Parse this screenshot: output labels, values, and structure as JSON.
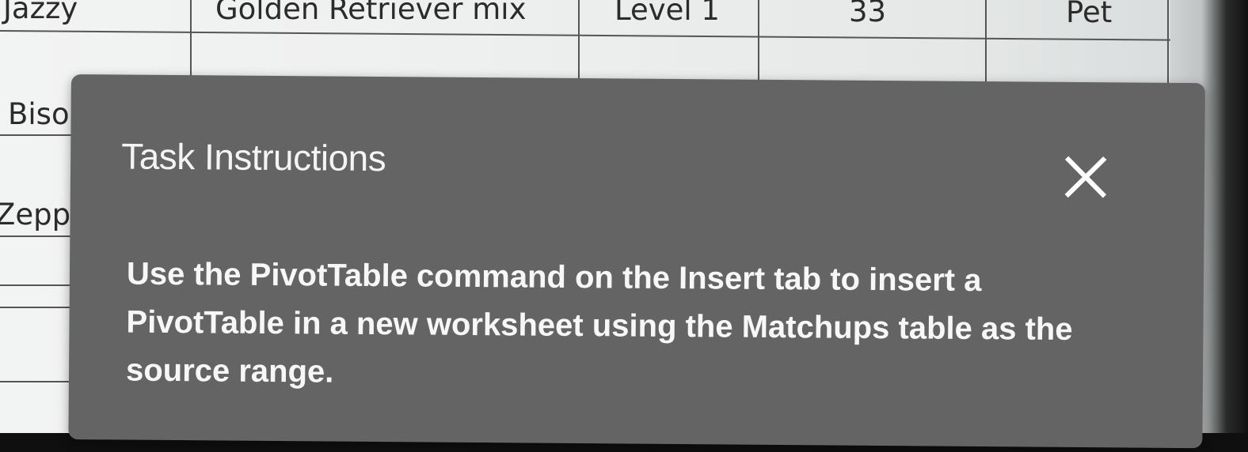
{
  "spreadsheet": {
    "row_top": {
      "name": "Jazzy",
      "breed": "Golden Retriever mix",
      "level": "Level 1",
      "number": "33",
      "type": "Pet"
    },
    "left_cells": [
      "Biso",
      "Zeppe"
    ]
  },
  "dialog": {
    "title": "Task Instructions",
    "close_icon": "close-x-icon",
    "instruction": "Use the PivotTable command on the Insert tab to insert a PivotTable in a new worksheet using the Matchups table as the source range."
  },
  "colors": {
    "dialog_bg": "#646464",
    "dialog_text": "#f7f7f7"
  }
}
